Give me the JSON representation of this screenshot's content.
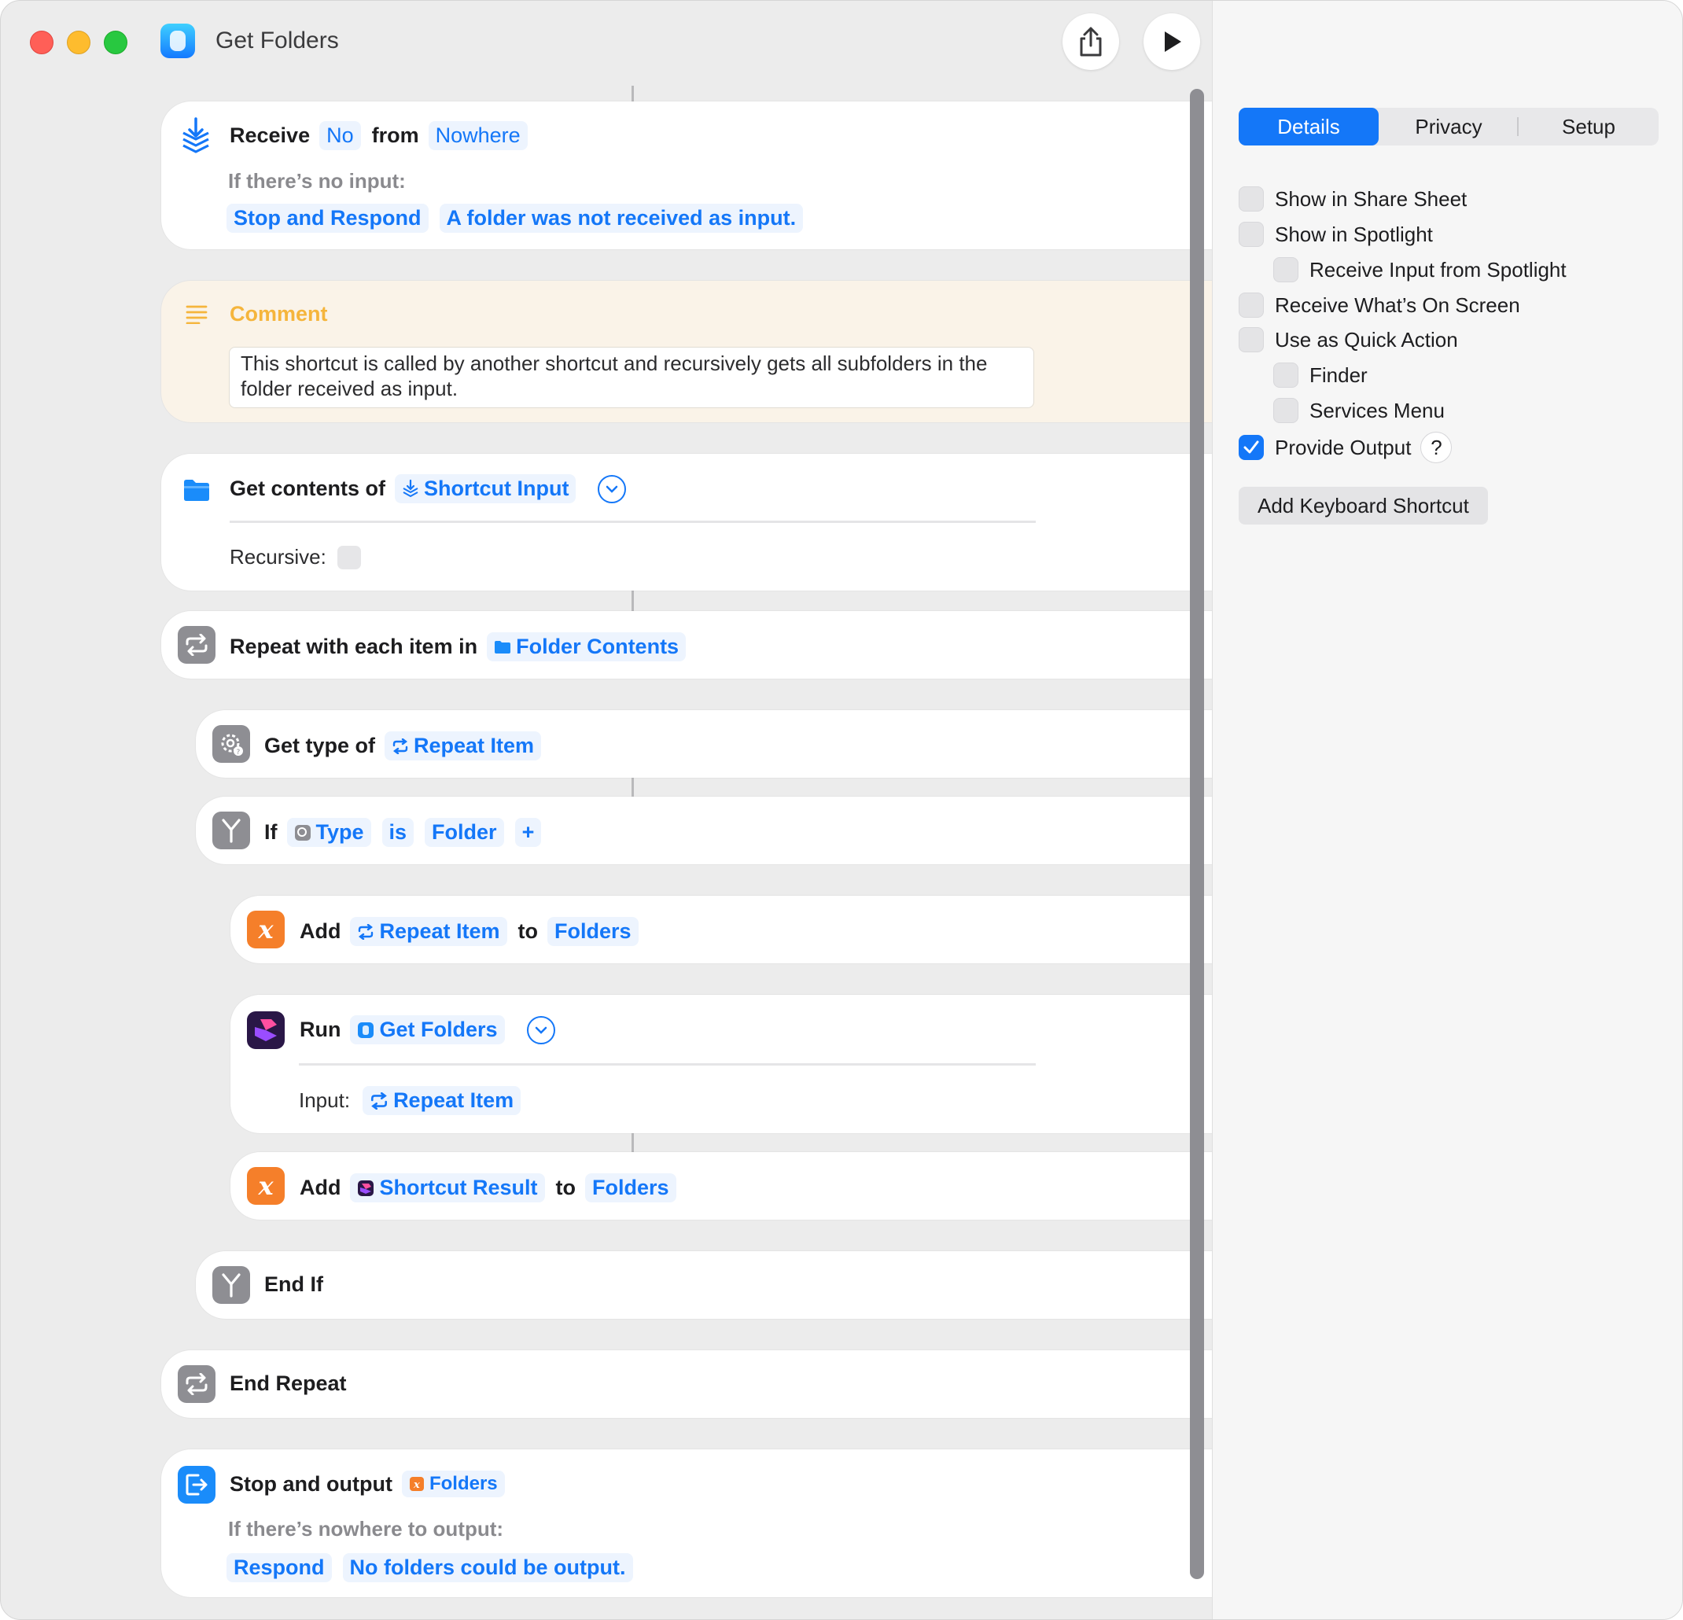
{
  "window": {
    "title": "Get Folders"
  },
  "toolbar": {
    "share_icon": "share-icon",
    "run_icon": "play-icon",
    "library_icon": "library-icon",
    "info_icon": "info-icon"
  },
  "actions": {
    "receive": {
      "label": "Receive",
      "input_token": "No",
      "from_label": "from",
      "source_token": "Nowhere",
      "no_input_label": "If there’s no input:",
      "no_input_action": "Stop and Respond",
      "no_input_message": "A folder was not received as input."
    },
    "comment": {
      "title": "Comment",
      "text": "This shortcut is called by another shortcut and recursively gets all subfolders in the folder received as input."
    },
    "get_contents": {
      "label": "Get contents of",
      "token": "Shortcut Input",
      "recursive_label": "Recursive:"
    },
    "repeat": {
      "label": "Repeat with each item in",
      "token": "Folder Contents"
    },
    "get_type": {
      "label": "Get type of",
      "token": "Repeat Item"
    },
    "if": {
      "label": "If",
      "token_type": "Type",
      "token_op": "is",
      "token_value": "Folder",
      "add_symbol": "+"
    },
    "add1": {
      "label": "Add",
      "token": "Repeat Item",
      "to_label": "to",
      "target": "Folders"
    },
    "run": {
      "label": "Run",
      "token": "Get Folders",
      "input_label": "Input:",
      "input_token": "Repeat Item"
    },
    "add2": {
      "label": "Add",
      "token": "Shortcut Result",
      "to_label": "to",
      "target": "Folders"
    },
    "end_if": {
      "label": "End If"
    },
    "end_repeat": {
      "label": "End Repeat"
    },
    "stop": {
      "label": "Stop and output",
      "token": "Folders",
      "nowhere_label": "If there’s nowhere to output:",
      "action": "Respond",
      "message": "No folders could be output."
    }
  },
  "inspector": {
    "tabs": [
      {
        "label": "Details",
        "active": true
      },
      {
        "label": "Privacy"
      },
      {
        "label": "Setup"
      }
    ],
    "options": [
      {
        "label": "Show in Share Sheet",
        "checked": false
      },
      {
        "label": "Show in Spotlight",
        "checked": false
      },
      {
        "label": "Receive Input from Spotlight",
        "checked": false
      },
      {
        "label": "Receive What’s On Screen",
        "checked": false
      },
      {
        "label": "Use as Quick Action",
        "checked": false
      },
      {
        "label": "Finder",
        "checked": false
      },
      {
        "label": "Services Menu",
        "checked": false
      },
      {
        "label": "Provide Output",
        "checked": true
      }
    ],
    "help_symbol": "?",
    "keyboard_button": "Add Keyboard Shortcut"
  },
  "colors": {
    "accent": "#1477f8",
    "variable_orange": "#f57f2a",
    "comment_bg": "#faf3e8",
    "comment_title": "#f5b53c"
  }
}
